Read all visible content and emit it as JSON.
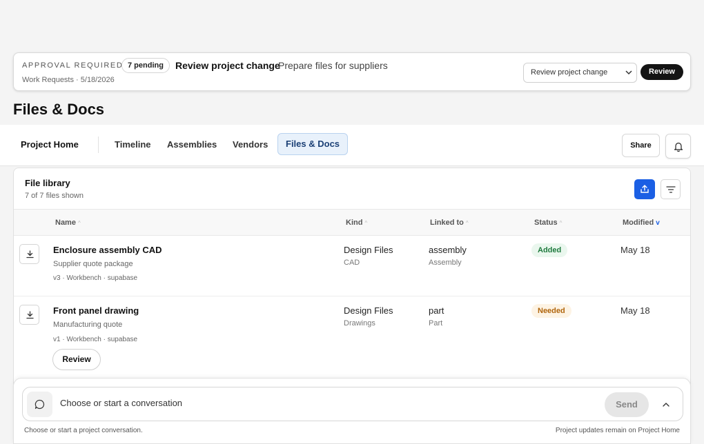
{
  "approval": {
    "kicker": "APPROVAL REQUIRED",
    "pending": "7 pending",
    "title": "Review project change",
    "subtitle": "Prepare files for suppliers",
    "meta": "Work Requests · 5/18/2026",
    "select_value": "Review project change",
    "review_label": "Review"
  },
  "page": {
    "title": "Files & Docs"
  },
  "nav": {
    "home": "Project Home",
    "tabs": [
      "Timeline",
      "Assemblies",
      "Vendors",
      "Files & Docs"
    ],
    "active_tab": "Files & Docs",
    "share_label": "Share"
  },
  "library": {
    "title": "File library",
    "count": "7 of 7 files shown",
    "columns": {
      "name": "Name",
      "kind": "Kind",
      "linked_to": "Linked to",
      "status": "Status",
      "modified": "Modified"
    },
    "sort_indicator": "v",
    "rows": [
      {
        "name": "Enclosure assembly CAD",
        "description": "Supplier quote package",
        "meta": "v3 · Workbench · supabase",
        "kind": "Design Files",
        "kind_sub": "CAD",
        "linked": "assembly",
        "linked_sub": "Assembly",
        "status": "Added",
        "modified": "May 18"
      },
      {
        "name": "Front panel drawing",
        "description": "Manufacturing quote",
        "meta": "v1 · Workbench · supabase",
        "kind": "Design Files",
        "kind_sub": "Drawings",
        "linked": "part",
        "linked_sub": "Part",
        "status": "Needed",
        "modified": "May 18",
        "action": "Review"
      }
    ]
  },
  "chat": {
    "placeholder": "Choose or start a conversation",
    "send_label": "Send",
    "hint_left": "Choose or start a project conversation.",
    "hint_right": "Project updates remain on Project Home"
  },
  "colors": {
    "accent": "#1b5fe4",
    "active_tab_bg": "#e8f1fb",
    "added_bg": "#eaf7ee",
    "added_text": "#1f7a3e",
    "needed_bg": "#fdf3e4",
    "needed_text": "#b0650c"
  }
}
